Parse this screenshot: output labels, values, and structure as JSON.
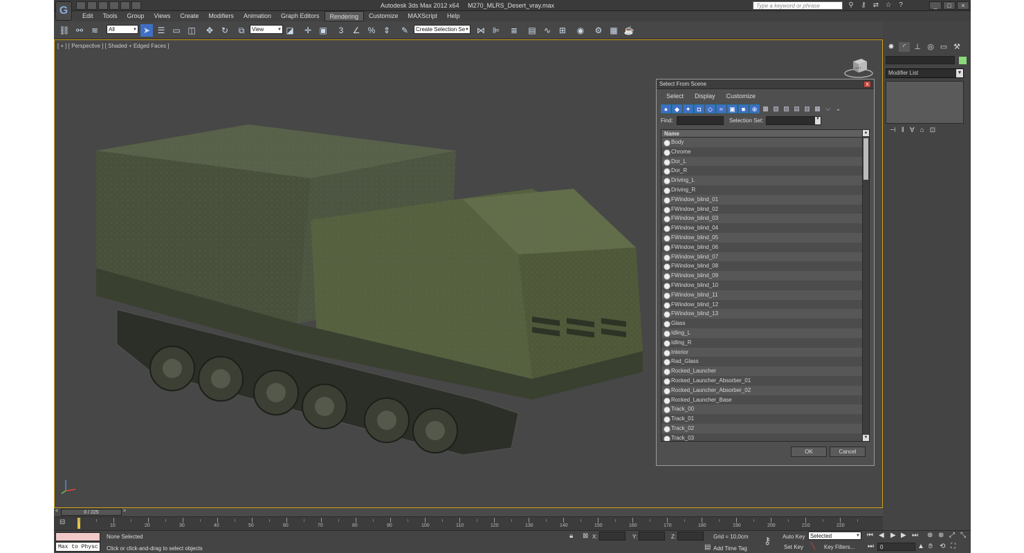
{
  "app": {
    "logo": "G",
    "title": "Autodesk 3ds Max  2012 x64",
    "filename": "M270_MLRS_Desert_vray.max",
    "search_placeholder": "Type a keyword or phrase"
  },
  "menu": [
    "Edit",
    "Tools",
    "Group",
    "Views",
    "Create",
    "Modifiers",
    "Animation",
    "Graph Editors",
    "Rendering",
    "Customize",
    "MAXScript",
    "Help"
  ],
  "menu_active": "Rendering",
  "toolbar": {
    "filter_value": "All",
    "refcoord_value": "View",
    "selection_set_value": "Create Selection Se"
  },
  "viewport": {
    "label": "[ + ] [ Perspective ] [ Shaded + Edged Faces ]",
    "viewcube_label": "LEFT"
  },
  "dialog": {
    "title": "Select From Scene",
    "close": "x",
    "menu": [
      "Select",
      "Display",
      "Customize"
    ],
    "find_label": "Find:",
    "selection_set_label": "Selection Set:",
    "column_name": "Name",
    "items": [
      "Body",
      "Chrome",
      "Dor_L",
      "Dor_R",
      "Driving_L",
      "Driving_R",
      "FWindow_blind_01",
      "FWindow_blind_02",
      "FWindow_blind_03",
      "FWindow_blind_04",
      "FWindow_blind_05",
      "FWindow_blind_06",
      "FWindow_blind_07",
      "FWindow_blind_08",
      "FWindow_blind_09",
      "FWindow_blind_10",
      "FWindow_blind_11",
      "FWindow_blind_12",
      "FWindow_blind_13",
      "Glass",
      "Idling_L",
      "Idling_R",
      "Interior",
      "Rad_Glass",
      "Rocked_Launcher",
      "Rocked_Launcher_Absorber_01",
      "Rocked_Launcher_Absorber_02",
      "Rocked_Launcher_Base",
      "Track_00",
      "Track_01",
      "Track_02",
      "Track_03"
    ],
    "ok_label": "OK",
    "cancel_label": "Cancel"
  },
  "command_panel": {
    "modifier_list": "Modifier List",
    "object_color": "#8cd97a"
  },
  "timeline": {
    "frame_display": "0 / 225",
    "prev": "<",
    "next": ">",
    "ticks": [
      10,
      20,
      30,
      40,
      50,
      60,
      70,
      80,
      90,
      100,
      110,
      120,
      130,
      140,
      150,
      160,
      170,
      180,
      190,
      200,
      210,
      220
    ]
  },
  "status": {
    "maxscript_text": "Max to Physc",
    "selection_info": "None Selected",
    "prompt": "Click or click-and-drag to select objects",
    "x_label": "X:",
    "y_label": "Y:",
    "z_label": "Z:",
    "grid": "Grid = 10,0cm",
    "add_time_tag": "Add Time Tag",
    "auto_key": "Auto Key",
    "set_key": "Set Key",
    "key_mode_value": "Selected",
    "key_filters": "Key Filters...",
    "frame_value": "0"
  }
}
